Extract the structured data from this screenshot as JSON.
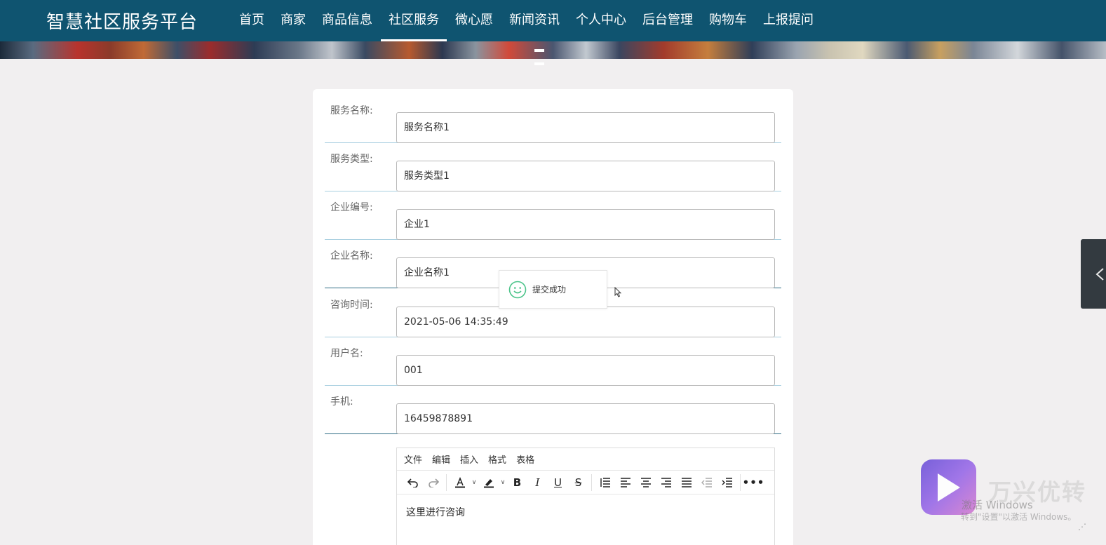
{
  "nav": {
    "brand": "智慧社区服务平台",
    "items": [
      "首页",
      "商家",
      "商品信息",
      "社区服务",
      "微心愿",
      "新闻资讯",
      "个人中心",
      "后台管理",
      "购物车",
      "上报提问"
    ],
    "active_index": 3
  },
  "form": {
    "rows": [
      {
        "label": "服务名称:",
        "value": "服务名称1"
      },
      {
        "label": "服务类型:",
        "value": "服务类型1"
      },
      {
        "label": "企业编号:",
        "value": "企业1"
      },
      {
        "label": "企业名称:",
        "value": "企业名称1"
      },
      {
        "label": "咨询时间:",
        "value": "2021-05-06 14:35:49"
      },
      {
        "label": "用户名:",
        "value": "001"
      },
      {
        "label": "手机:",
        "value": "16459878891"
      }
    ]
  },
  "editor": {
    "menu": [
      "文件",
      "编辑",
      "插入",
      "格式",
      "表格"
    ],
    "content": "这里进行咨询"
  },
  "toast": {
    "message": "提交成功",
    "accent": "#4cc48a"
  },
  "watermark": {
    "brand": "万兴优转",
    "activate_line1": "激活 Windows",
    "activate_line2": "转到\"设置\"以激活 Windows。"
  },
  "colors": {
    "nav_bg": "#0f5470",
    "row_divider": "#a8cfe0"
  }
}
